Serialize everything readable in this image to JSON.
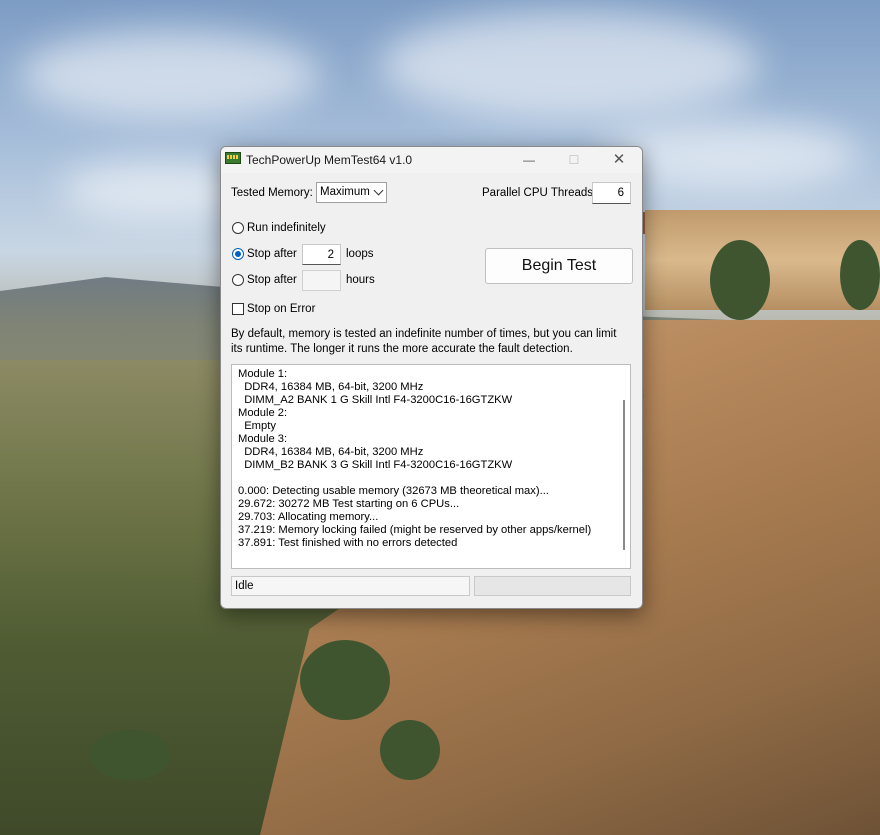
{
  "window": {
    "title": "TechPowerUp MemTest64 v1.0"
  },
  "settings": {
    "tested_memory_label": "Tested Memory:",
    "tested_memory_value": "Maximum",
    "threads_label": "Parallel CPU Threads:",
    "threads_value": "6"
  },
  "options": {
    "run_indefinitely_label": "Run indefinitely",
    "stop_after_loops_label": "Stop after",
    "loops_value": "2",
    "loops_unit": "loops",
    "stop_after_hours_label": "Stop after",
    "hours_value": "",
    "hours_unit": "hours",
    "stop_on_error_label": "Stop on Error",
    "selected": "stop_after_loops",
    "stop_on_error_checked": false
  },
  "begin_button_label": "Begin Test",
  "description": "By default, memory is tested an indefinite number of times, but you can limit its runtime. The longer it runs the more accurate the fault detection.",
  "log": [
    "Module 1:",
    "  DDR4, 16384 MB, 64-bit, 3200 MHz",
    "  DIMM_A2 BANK 1 G Skill Intl F4-3200C16-16GTZKW",
    "Module 2:",
    "  Empty",
    "Module 3:",
    "  DDR4, 16384 MB, 64-bit, 3200 MHz",
    "  DIMM_B2 BANK 3 G Skill Intl F4-3200C16-16GTZKW",
    "",
    "0.000: Detecting usable memory (32673 MB theoretical max)...",
    "29.672: 30272 MB Test starting on 6 CPUs...",
    "29.703: Allocating memory...",
    "37.219: Memory locking failed (might be reserved by other apps/kernel)",
    "37.891: Test finished with no errors detected"
  ],
  "status": {
    "text": "Idle",
    "progress": 0
  },
  "icons": {
    "app": "memory-module-icon",
    "minimize": "minimize-icon",
    "maximize": "maximize-icon",
    "close": "close-icon"
  }
}
